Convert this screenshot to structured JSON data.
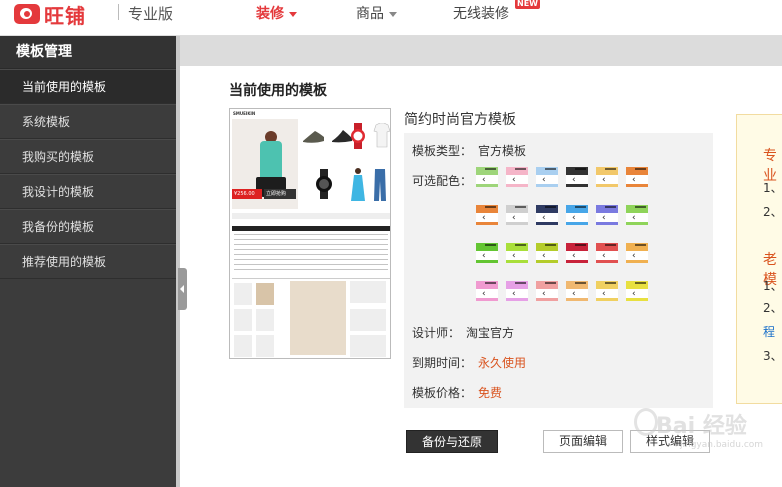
{
  "header": {
    "logo_text": "旺铺",
    "edition": "专业版",
    "nav": [
      {
        "label": "装修",
        "active": true,
        "has_caret": true
      },
      {
        "label": "商品",
        "active": false,
        "has_caret": true
      },
      {
        "label": "无线装修",
        "active": false,
        "has_caret": false,
        "badge": "NEW"
      }
    ]
  },
  "sidebar": {
    "title": "模板管理",
    "items": [
      {
        "label": "当前使用的模板",
        "active": true
      },
      {
        "label": "系统模板",
        "active": false
      },
      {
        "label": "我购买的模板",
        "active": false
      },
      {
        "label": "我设计的模板",
        "active": false
      },
      {
        "label": "我备份的模板",
        "active": false
      },
      {
        "label": "推荐使用的模板",
        "active": false
      }
    ]
  },
  "main": {
    "section_title": "当前使用的模板",
    "thumbnail": {
      "logo": "SMUEIKIN",
      "price": "¥256.00",
      "price_btn": "立即抢购"
    },
    "template_name": "简约时尚官方模板",
    "type_label": "模板类型：",
    "type_value": "官方模板",
    "color_label": "可选配色：",
    "designer_label": "设计师：",
    "designer_value": "淘宝官方",
    "expire_label": "到期时间：",
    "expire_value": "永久使用",
    "price_label": "模板价格：",
    "price_value": "免费",
    "swatches": [
      [
        "#9ed57a",
        "#f5b5c8",
        "#a9cff0",
        "#333333",
        "#f2c86a",
        "#e9853a"
      ],
      [
        "#e9853a",
        "#cfcfcf",
        "#2f3b63",
        "#47a6e8",
        "#7a7ae0",
        "#8fd45a"
      ],
      [
        "#63c532",
        "#a9df3a",
        "#b4cc2a",
        "#c8223a",
        "#e15050",
        "#f0b050"
      ],
      [
        "#f09ad0",
        "#e6a0e6",
        "#f0a0a0",
        "#f0b870",
        "#f0d060",
        "#e8e040"
      ]
    ],
    "buttons": {
      "backup": "备份与还原",
      "page_edit": "页面编辑",
      "style_edit": "样式编辑"
    }
  },
  "right_panel": {
    "title1": "专业",
    "items1": [
      "1、",
      "2、"
    ],
    "title2": "老模",
    "items2": [
      "1、",
      "2、",
      "3、"
    ],
    "link": "程"
  },
  "watermark": {
    "text": "Bai 经验",
    "sub": "jingyan.baidu.com"
  }
}
